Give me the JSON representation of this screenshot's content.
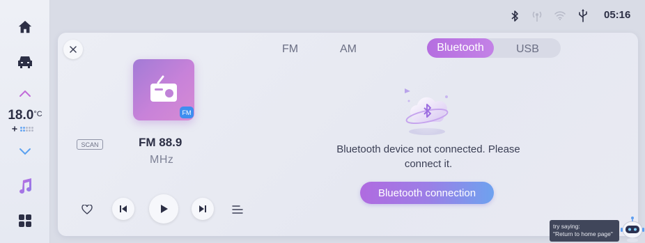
{
  "status": {
    "time": "05:16",
    "icons": [
      "bluetooth-icon",
      "signal-icon",
      "wifi-icon",
      "usb-icon"
    ]
  },
  "rail": {
    "items": [
      "home-icon",
      "car-icon",
      "chevron-up-icon",
      "chevron-down-icon",
      "music-icon",
      "apps-icon"
    ],
    "temperature": {
      "value": "18.0",
      "unit": "°C"
    },
    "fan_level": 2
  },
  "radio": {
    "badge": "FM",
    "scan_label": "SCAN",
    "frequency": "FM 88.9",
    "unit": "MHz"
  },
  "tabs": [
    {
      "label": "FM",
      "active": false
    },
    {
      "label": "AM",
      "active": false
    },
    {
      "label": "Bluetooth",
      "active": true
    },
    {
      "label": "USB",
      "active": false
    }
  ],
  "bluetooth": {
    "message": "Bluetooth device not connected. Please connect it.",
    "button_label": "Bluetooth connection"
  },
  "voice": {
    "hint_line1": "try saying:",
    "hint_line2": "\"Return to home page\""
  },
  "colors": {
    "accent": "#b56ee0",
    "accent_blue": "#6ea2ef",
    "text": "#2c2f45"
  }
}
